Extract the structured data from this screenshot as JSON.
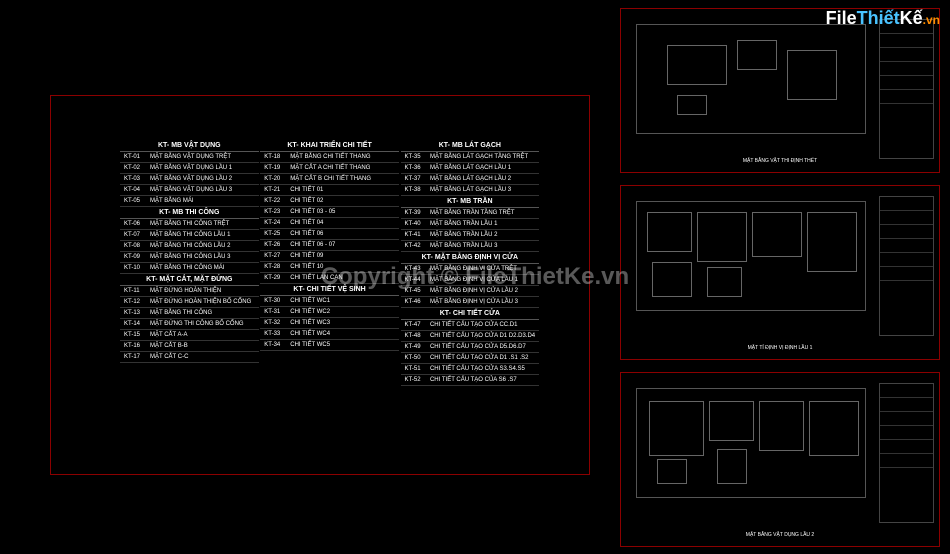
{
  "watermark": {
    "logo_file": "File",
    "logo_thiet": "Thiết",
    "logo_ke": "Kế",
    "logo_vn": ".vn",
    "center_text": "Copyright © FileThietKe.vn"
  },
  "columns": [
    {
      "header": "KT- MB VẬT DỤNG",
      "rows": [
        {
          "code": "KT-01",
          "name": "MẶT BẰNG VẬT DỤNG TRỆT"
        },
        {
          "code": "KT-02",
          "name": "MẶT BẰNG VẬT DỤNG LẦU 1"
        },
        {
          "code": "KT-03",
          "name": "MẶT BẰNG VẬT DỤNG LẦU 2"
        },
        {
          "code": "KT-04",
          "name": "MẶT BẰNG VẬT DỤNG LẦU 3"
        },
        {
          "code": "KT-05",
          "name": "MẶT BẰNG MÁI"
        }
      ],
      "header2": "KT- MB THI CÔNG",
      "rows2": [
        {
          "code": "KT-06",
          "name": "MẶT BẰNG THI CÔNG TRỆT"
        },
        {
          "code": "KT-07",
          "name": "MẶT BẰNG THI CÔNG LẦU 1"
        },
        {
          "code": "KT-08",
          "name": "MẶT BẰNG THI CÔNG LẦU 2"
        },
        {
          "code": "KT-09",
          "name": "MẶT BẰNG THI CÔNG LẦU 3"
        },
        {
          "code": "KT-10",
          "name": "MẶT BẰNG THI CÔNG MÁI"
        }
      ],
      "header3": "KT- MẶT CẮT, MẶT ĐỨNG",
      "rows3": [
        {
          "code": "KT-11",
          "name": "MẶT ĐỨNG HOÀN THIỆN"
        },
        {
          "code": "KT-12",
          "name": "MẶT ĐỨNG HOÀN THIỆN BỐ CỔNG"
        },
        {
          "code": "KT-13",
          "name": "MẶT BẰNG THI CÔNG"
        },
        {
          "code": "KT-14",
          "name": "MẶT ĐỨNG THI CÔNG BỐ CỔNG"
        },
        {
          "code": "KT-15",
          "name": "MẶT CẮT A-A"
        },
        {
          "code": "KT-16",
          "name": "MẶT CẮT B-B"
        },
        {
          "code": "KT-17",
          "name": "MẶT CẮT C-C"
        }
      ]
    },
    {
      "header": "KT- KHAI TRIỂN CHI TIẾT",
      "rows": [
        {
          "code": "KT-18",
          "name": "MẶT BẰNG CHI TIẾT THANG"
        },
        {
          "code": "KT-19",
          "name": "MẶT CẮT A CHI TIẾT THANG"
        },
        {
          "code": "KT-20",
          "name": "MẶT CẮT B CHI TIẾT THANG"
        },
        {
          "code": "KT-21",
          "name": "CHI TIẾT 01"
        },
        {
          "code": "KT-22",
          "name": "CHI TIẾT 02"
        },
        {
          "code": "KT-23",
          "name": "CHI TIẾT 03 - 05"
        },
        {
          "code": "KT-24",
          "name": "CHI TIẾT 04"
        },
        {
          "code": "KT-25",
          "name": "CHI TIẾT 06"
        },
        {
          "code": "KT-26",
          "name": "CHI TIẾT 06 - 07"
        },
        {
          "code": "KT-27",
          "name": "CHI TIẾT 09"
        },
        {
          "code": "KT-28",
          "name": "CHI TIẾT 10"
        },
        {
          "code": "KT-29",
          "name": "CHI TIẾT LAN CAN"
        }
      ],
      "header2": "KT- CHI TIẾT VỆ SINH",
      "rows2": [
        {
          "code": "KT-30",
          "name": "CHI TIẾT WC1"
        },
        {
          "code": "KT-31",
          "name": "CHI TIẾT WC2"
        },
        {
          "code": "KT-32",
          "name": "CHI TIẾT WC3"
        },
        {
          "code": "KT-33",
          "name": "CHI TIẾT WC4"
        },
        {
          "code": "KT-34",
          "name": "CHI TIẾT WC5"
        }
      ]
    },
    {
      "header": "KT- MB LÁT GẠCH",
      "rows": [
        {
          "code": "KT-35",
          "name": "MẶT BẰNG LÁT GẠCH TẦNG TRỆT"
        },
        {
          "code": "KT-36",
          "name": "MẶT BẰNG LÁT GẠCH LẦU 1"
        },
        {
          "code": "KT-37",
          "name": "MẶT BẰNG LÁT GẠCH LẦU 2"
        },
        {
          "code": "KT-38",
          "name": "MẶT BẰNG LÁT GẠCH LẦU 3"
        }
      ],
      "header2": "KT- MB TRẦN",
      "rows2": [
        {
          "code": "KT-39",
          "name": "MẶT BẰNG TRẦN TẦNG TRỆT"
        },
        {
          "code": "KT-40",
          "name": "MẶT BẰNG TRẦN LẦU 1"
        },
        {
          "code": "KT-41",
          "name": "MẶT BẰNG TRẦN LẦU 2"
        },
        {
          "code": "KT-42",
          "name": "MẶT BẰNG TRẦN LẦU 3"
        }
      ],
      "header3": "KT- MẶT BẰNG ĐỊNH VỊ CỬA",
      "rows3": [
        {
          "code": "KT-43",
          "name": "MẶT BẰNG ĐỊNH VỊ CỬA TRỆT"
        },
        {
          "code": "KT-44",
          "name": "MẶT BẰNG ĐỊNH VỊ CỬA LẦU 1"
        },
        {
          "code": "KT-45",
          "name": "MẶT BẰNG ĐỊNH VỊ CỬA LẦU 2"
        },
        {
          "code": "KT-46",
          "name": "MẶT BẰNG ĐỊNH VỊ CỬA LẦU 3"
        }
      ],
      "header4": "KT- CHI TIẾT CỬA",
      "rows4": [
        {
          "code": "KT-47",
          "name": "CHI TIẾT CẤU TẠO CỬA CC.D1"
        },
        {
          "code": "KT-48",
          "name": "CHI TIẾT CẤU TẠO CỬA D1 D2.D3.D4"
        },
        {
          "code": "KT-49",
          "name": "CHI TIẾT CẤU TẠO CỬA D5.D6.D7"
        },
        {
          "code": "KT-50",
          "name": "CHI TIẾT CẤU TẠO CỬA D1 .S1 .S2"
        },
        {
          "code": "KT-51",
          "name": "CHI TIẾT CẤU TẠO CỬA S3.S4.S5"
        },
        {
          "code": "KT-52",
          "name": "CHI TIẾT CẤU TẠO CỦA S6 .S7"
        }
      ]
    }
  ],
  "plans": [
    {
      "label": "MẶT BẰNG VẬT THI ĐỊNH THỂT"
    },
    {
      "label": "MẶT TỈ ĐỊNH VỊ ĐỊNH LẦU 1"
    },
    {
      "label": "MẶT BẰNG VẬT DỤNG LẦU 2"
    }
  ]
}
